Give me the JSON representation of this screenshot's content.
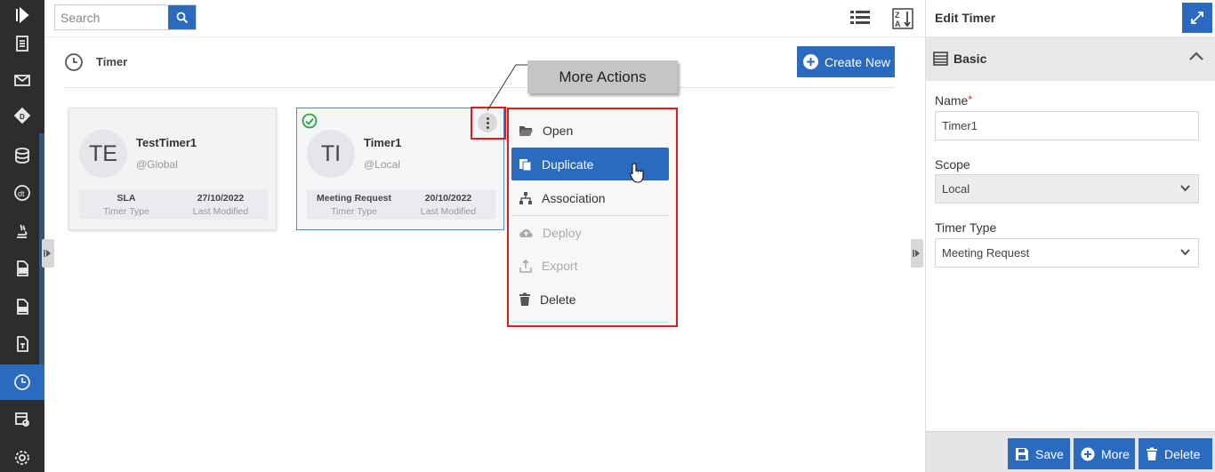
{
  "search": {
    "placeholder": "Search"
  },
  "page": {
    "title": "Timer",
    "create_label": "Create New"
  },
  "cards": [
    {
      "initials": "TE",
      "name": "TestTimer1",
      "scope": "@Global",
      "type_value": "SLA",
      "type_label": "Timer Type",
      "date_value": "27/10/2022",
      "date_label": "Last Modified"
    },
    {
      "initials": "TI",
      "name": "Timer1",
      "scope": "@Local",
      "type_value": "Meeting Request",
      "type_label": "Timer Type",
      "date_value": "20/10/2022",
      "date_label": "Last Modified"
    }
  ],
  "callout": {
    "text": "More Actions"
  },
  "menu": {
    "items": [
      {
        "label": "Open",
        "icon": "folder-open-icon",
        "state": "normal"
      },
      {
        "label": "Duplicate",
        "icon": "copy-icon",
        "state": "active"
      },
      {
        "label": "Association",
        "icon": "sitemap-icon",
        "state": "normal"
      },
      {
        "label": "Deploy",
        "icon": "cloud-upload-icon",
        "state": "disabled"
      },
      {
        "label": "Export",
        "icon": "export-icon",
        "state": "disabled"
      },
      {
        "label": "Delete",
        "icon": "trash-icon",
        "state": "normal"
      }
    ]
  },
  "panel": {
    "title": "Edit Timer",
    "section": "Basic",
    "name_label": "Name",
    "required_mark": "*",
    "name_value": "Timer1",
    "scope_label": "Scope",
    "scope_value": "Local",
    "type_label": "Timer Type",
    "type_value": "Meeting Request",
    "save_label": "Save",
    "more_label": "More",
    "delete_label": "Delete"
  },
  "colors": {
    "accent": "#2a6bbf",
    "sidebar": "#2d2d2d",
    "highlight": "#e01d1d"
  }
}
